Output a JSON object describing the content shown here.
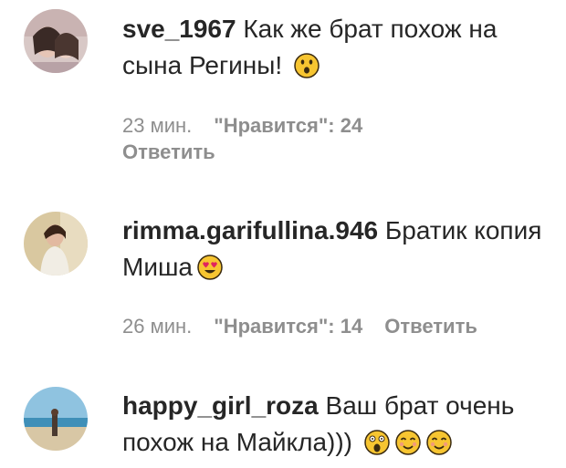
{
  "comments": [
    {
      "username": "sve_1967",
      "text": "Как же брат похож на сына Регины!",
      "emojis": [
        "astonished-face"
      ],
      "time": "23 мин.",
      "likes": "\"Нравится\": 24",
      "reply": "Ответить"
    },
    {
      "username": "rimma.garifullina.946",
      "text": "Братик копия Миша",
      "emojis": [
        "heart-eyes-face"
      ],
      "time": "26 мин.",
      "likes": "\"Нравится\": 14",
      "reply": "Ответить"
    },
    {
      "username": "happy_girl_roza",
      "text": "Ваш брат очень похож на Майкла)))",
      "emojis": [
        "screaming-face",
        "smiling-face",
        "smiling-face"
      ]
    }
  ],
  "colors": {
    "text": "#262626",
    "meta": "#8e8e8e",
    "emoji": "#f7c531"
  }
}
